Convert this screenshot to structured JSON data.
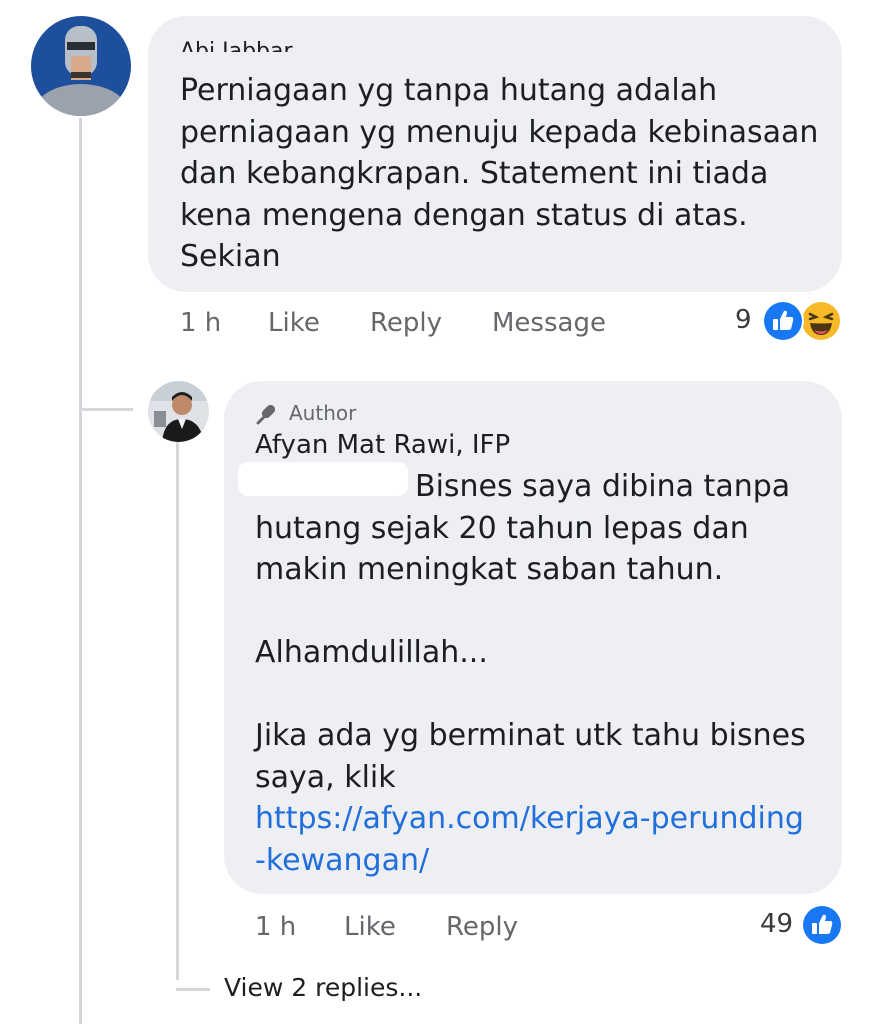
{
  "comment1": {
    "author_partial": "Abi Jabbar",
    "lines": [
      "Perniagaan yg tanpa hutang adalah",
      "perniagaan yg menuju kepada kebinasaan",
      "dan kebangkrapan. Statement ini tiada",
      "kena mengena dengan status di atas.",
      "Sekian"
    ],
    "time": "1 h",
    "like_label": "Like",
    "reply_label": "Reply",
    "message_label": "Message",
    "reaction_count": "9",
    "reactions": [
      "like-icon",
      "haha-icon"
    ]
  },
  "comment2": {
    "badge": "Author",
    "author": "Afyan Mat Rawi, IFP",
    "lines": [
      "Bisnes saya dibina tanpa",
      "hutang sejak 20 tahun lepas dan",
      "makin meningkat saban tahun.",
      "",
      "Alhamdulillah...",
      "",
      "Jika ada yg berminat utk tahu bisnes",
      "saya, klik"
    ],
    "link_lines": [
      "https://afyan.com/kerjaya-perunding",
      "-kewangan/"
    ],
    "time": "1 h",
    "like_label": "Like",
    "reply_label": "Reply",
    "reaction_count": "49",
    "reactions": [
      "like-icon"
    ]
  },
  "view_replies": "View 2 replies...",
  "colors": {
    "bubble": "#eeeff3",
    "link": "#216fdb",
    "like_blue": "#1877f2",
    "haha_yellow": "#f7b928",
    "meta_gray": "#65676b"
  }
}
